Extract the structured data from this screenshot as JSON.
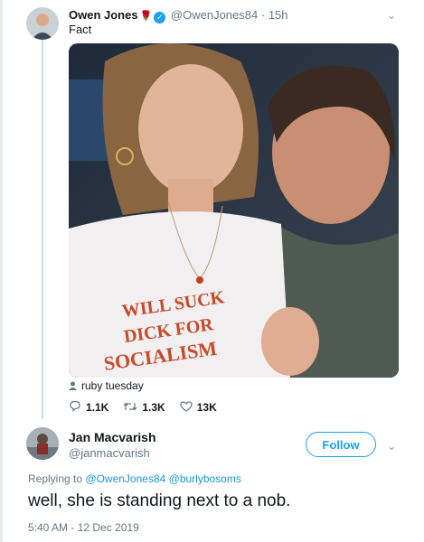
{
  "tweet": {
    "author_name": "Owen Jones",
    "author_emoji": "🌹",
    "handle": "@OwenJones84",
    "time": "15h",
    "separator": "·",
    "text": "Fact",
    "photo_shirt_text": [
      "WILL SUCK",
      "DICK FOR",
      "SOCIALISM"
    ],
    "photo_credit": "ruby tuesday",
    "stats": {
      "replies": "1.1K",
      "retweets": "1.3K",
      "likes": "13K"
    }
  },
  "reply": {
    "author_name": "Jan Macvarish",
    "handle": "@janmacvarish",
    "follow_label": "Follow",
    "replying_prefix": "Replying to",
    "mention1": "@OwenJones84",
    "mention2": "@burlybosoms",
    "text": "well, she is standing next to a nob.",
    "timestamp": "5:40 AM - 12 Dec 2019"
  },
  "icons": [
    "verified-icon",
    "chevron-down-icon",
    "user-icon",
    "reply-icon",
    "retweet-icon",
    "like-icon"
  ],
  "colors": {
    "accent": "#1da1f2",
    "link": "#1b95e0",
    "muted": "#657786",
    "thread": "#c7dceb"
  }
}
